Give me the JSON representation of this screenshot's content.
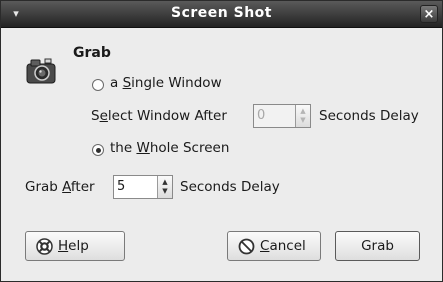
{
  "window": {
    "title": "Screen Shot",
    "menu_glyph": "▾",
    "close_glyph": "×"
  },
  "grab_section": {
    "heading": "Grab",
    "single_window": {
      "before": "a ",
      "mnemonic": "S",
      "after": "ingle Window",
      "selected": false
    },
    "select_window_after": {
      "label_before": "S",
      "label_mnemonic": "e",
      "label_after": "lect Window After",
      "value": "0",
      "suffix": "Seconds Delay",
      "enabled": false
    },
    "whole_screen": {
      "before": "the ",
      "mnemonic": "W",
      "after": "hole Screen",
      "selected": true
    }
  },
  "grab_after": {
    "label_before": "Grab ",
    "label_mnemonic": "A",
    "label_after": "fter",
    "value": "5",
    "suffix": "Seconds Delay"
  },
  "buttons": {
    "help": {
      "mnemonic": "H",
      "rest": "elp",
      "icon": "help-icon"
    },
    "cancel": {
      "mnemonic": "C",
      "rest": "ancel",
      "icon": "cancel-icon"
    },
    "grab": {
      "label": "Grab"
    }
  },
  "spin_arrows": {
    "up": "▲",
    "down": "▼"
  }
}
